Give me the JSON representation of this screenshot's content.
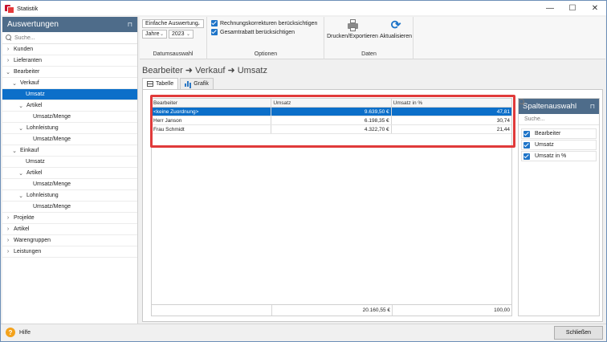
{
  "window": {
    "title": "Statistik",
    "minimize": "—",
    "maximize": "☐",
    "close": "✕"
  },
  "sidebar": {
    "title": "Auswertungen",
    "pin": "⊓",
    "search_placeholder": "Suche...",
    "items": [
      {
        "label": "Kunden",
        "chev": "›",
        "level": 0,
        "selected": false
      },
      {
        "label": "Lieferanten",
        "chev": "›",
        "level": 0,
        "selected": false
      },
      {
        "label": "Bearbeiter",
        "chev": "⌄",
        "level": 0,
        "selected": false
      },
      {
        "label": "Verkauf",
        "chev": "⌄",
        "level": 1,
        "selected": false
      },
      {
        "label": "Umsatz",
        "chev": "",
        "level": 2,
        "selected": true
      },
      {
        "label": "Artikel",
        "chev": "⌄",
        "level": 2,
        "selected": false
      },
      {
        "label": "Umsatz/Menge",
        "chev": "",
        "level": 3,
        "selected": false
      },
      {
        "label": "Lohnleistung",
        "chev": "⌄",
        "level": 2,
        "selected": false
      },
      {
        "label": "Umsatz/Menge",
        "chev": "",
        "level": 3,
        "selected": false
      },
      {
        "label": "Einkauf",
        "chev": "⌄",
        "level": 1,
        "selected": false
      },
      {
        "label": "Umsatz",
        "chev": "",
        "level": 2,
        "selected": false
      },
      {
        "label": "Artikel",
        "chev": "⌄",
        "level": 2,
        "selected": false
      },
      {
        "label": "Umsatz/Menge",
        "chev": "",
        "level": 3,
        "selected": false
      },
      {
        "label": "Lohnleistung",
        "chev": "⌄",
        "level": 2,
        "selected": false
      },
      {
        "label": "Umsatz/Menge",
        "chev": "",
        "level": 3,
        "selected": false
      },
      {
        "label": "Projekte",
        "chev": "›",
        "level": 0,
        "selected": false
      },
      {
        "label": "Artikel",
        "chev": "›",
        "level": 0,
        "selected": false
      },
      {
        "label": "Warengruppen",
        "chev": "›",
        "level": 0,
        "selected": false
      },
      {
        "label": "Leistungen",
        "chev": "›",
        "level": 0,
        "selected": false
      }
    ]
  },
  "ribbon": {
    "datumsauswahl": {
      "label": "Datumsauswahl",
      "mode_value": "Einfache Auswertung",
      "period_value": "Jahre",
      "year_value": "2023"
    },
    "optionen": {
      "label": "Optionen",
      "opt1": "Rechnungskorrekturen berücksichtigen",
      "opt2": "Gesamtrabatt berücksichtigen"
    },
    "daten": {
      "label": "Daten",
      "print": "Drucken/Exportieren",
      "refresh": "Aktualisieren"
    }
  },
  "content": {
    "breadcrumb": "Bearbeiter ➜ Verkauf ➜ Umsatz",
    "tabs": {
      "table": "Tabelle",
      "chart": "Grafik"
    },
    "table": {
      "columns": [
        "Bearbeiter",
        "Umsatz",
        "Umsatz in %"
      ],
      "rows": [
        [
          "<keine Zuordnung>",
          "9.639,50 €",
          "47,81"
        ],
        [
          "Herr Janson",
          "6.198,35 €",
          "30,74"
        ],
        [
          "Frau Schmidt",
          "4.322,70 €",
          "21,44"
        ]
      ],
      "footer": [
        "",
        "20.160,55 €",
        "100,00"
      ]
    },
    "column_chooser": {
      "title": "Spaltenauswahl",
      "pin": "⊓",
      "search_placeholder": "Suche...",
      "items": [
        "Bearbeiter",
        "Umsatz",
        "Umsatz in %"
      ]
    }
  },
  "bottom": {
    "help": "Hilfe",
    "help_glyph": "?",
    "close": "Schließen"
  },
  "colors": {
    "accent": "#0c6fc9",
    "header": "#4e6c8a",
    "highlight": "#e03a3a"
  }
}
